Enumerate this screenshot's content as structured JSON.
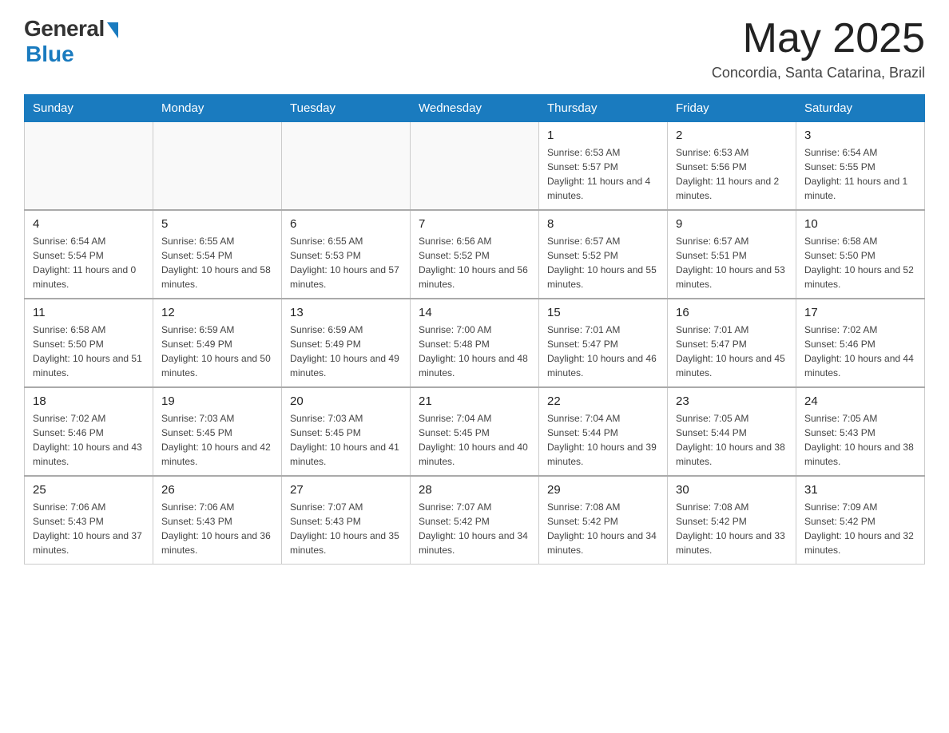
{
  "logo": {
    "general": "General",
    "blue": "Blue"
  },
  "title": "May 2025",
  "location": "Concordia, Santa Catarina, Brazil",
  "days_of_week": [
    "Sunday",
    "Monday",
    "Tuesday",
    "Wednesday",
    "Thursday",
    "Friday",
    "Saturday"
  ],
  "weeks": [
    [
      {
        "day": "",
        "info": ""
      },
      {
        "day": "",
        "info": ""
      },
      {
        "day": "",
        "info": ""
      },
      {
        "day": "",
        "info": ""
      },
      {
        "day": "1",
        "info": "Sunrise: 6:53 AM\nSunset: 5:57 PM\nDaylight: 11 hours and 4 minutes."
      },
      {
        "day": "2",
        "info": "Sunrise: 6:53 AM\nSunset: 5:56 PM\nDaylight: 11 hours and 2 minutes."
      },
      {
        "day": "3",
        "info": "Sunrise: 6:54 AM\nSunset: 5:55 PM\nDaylight: 11 hours and 1 minute."
      }
    ],
    [
      {
        "day": "4",
        "info": "Sunrise: 6:54 AM\nSunset: 5:54 PM\nDaylight: 11 hours and 0 minutes."
      },
      {
        "day": "5",
        "info": "Sunrise: 6:55 AM\nSunset: 5:54 PM\nDaylight: 10 hours and 58 minutes."
      },
      {
        "day": "6",
        "info": "Sunrise: 6:55 AM\nSunset: 5:53 PM\nDaylight: 10 hours and 57 minutes."
      },
      {
        "day": "7",
        "info": "Sunrise: 6:56 AM\nSunset: 5:52 PM\nDaylight: 10 hours and 56 minutes."
      },
      {
        "day": "8",
        "info": "Sunrise: 6:57 AM\nSunset: 5:52 PM\nDaylight: 10 hours and 55 minutes."
      },
      {
        "day": "9",
        "info": "Sunrise: 6:57 AM\nSunset: 5:51 PM\nDaylight: 10 hours and 53 minutes."
      },
      {
        "day": "10",
        "info": "Sunrise: 6:58 AM\nSunset: 5:50 PM\nDaylight: 10 hours and 52 minutes."
      }
    ],
    [
      {
        "day": "11",
        "info": "Sunrise: 6:58 AM\nSunset: 5:50 PM\nDaylight: 10 hours and 51 minutes."
      },
      {
        "day": "12",
        "info": "Sunrise: 6:59 AM\nSunset: 5:49 PM\nDaylight: 10 hours and 50 minutes."
      },
      {
        "day": "13",
        "info": "Sunrise: 6:59 AM\nSunset: 5:49 PM\nDaylight: 10 hours and 49 minutes."
      },
      {
        "day": "14",
        "info": "Sunrise: 7:00 AM\nSunset: 5:48 PM\nDaylight: 10 hours and 48 minutes."
      },
      {
        "day": "15",
        "info": "Sunrise: 7:01 AM\nSunset: 5:47 PM\nDaylight: 10 hours and 46 minutes."
      },
      {
        "day": "16",
        "info": "Sunrise: 7:01 AM\nSunset: 5:47 PM\nDaylight: 10 hours and 45 minutes."
      },
      {
        "day": "17",
        "info": "Sunrise: 7:02 AM\nSunset: 5:46 PM\nDaylight: 10 hours and 44 minutes."
      }
    ],
    [
      {
        "day": "18",
        "info": "Sunrise: 7:02 AM\nSunset: 5:46 PM\nDaylight: 10 hours and 43 minutes."
      },
      {
        "day": "19",
        "info": "Sunrise: 7:03 AM\nSunset: 5:45 PM\nDaylight: 10 hours and 42 minutes."
      },
      {
        "day": "20",
        "info": "Sunrise: 7:03 AM\nSunset: 5:45 PM\nDaylight: 10 hours and 41 minutes."
      },
      {
        "day": "21",
        "info": "Sunrise: 7:04 AM\nSunset: 5:45 PM\nDaylight: 10 hours and 40 minutes."
      },
      {
        "day": "22",
        "info": "Sunrise: 7:04 AM\nSunset: 5:44 PM\nDaylight: 10 hours and 39 minutes."
      },
      {
        "day": "23",
        "info": "Sunrise: 7:05 AM\nSunset: 5:44 PM\nDaylight: 10 hours and 38 minutes."
      },
      {
        "day": "24",
        "info": "Sunrise: 7:05 AM\nSunset: 5:43 PM\nDaylight: 10 hours and 38 minutes."
      }
    ],
    [
      {
        "day": "25",
        "info": "Sunrise: 7:06 AM\nSunset: 5:43 PM\nDaylight: 10 hours and 37 minutes."
      },
      {
        "day": "26",
        "info": "Sunrise: 7:06 AM\nSunset: 5:43 PM\nDaylight: 10 hours and 36 minutes."
      },
      {
        "day": "27",
        "info": "Sunrise: 7:07 AM\nSunset: 5:43 PM\nDaylight: 10 hours and 35 minutes."
      },
      {
        "day": "28",
        "info": "Sunrise: 7:07 AM\nSunset: 5:42 PM\nDaylight: 10 hours and 34 minutes."
      },
      {
        "day": "29",
        "info": "Sunrise: 7:08 AM\nSunset: 5:42 PM\nDaylight: 10 hours and 34 minutes."
      },
      {
        "day": "30",
        "info": "Sunrise: 7:08 AM\nSunset: 5:42 PM\nDaylight: 10 hours and 33 minutes."
      },
      {
        "day": "31",
        "info": "Sunrise: 7:09 AM\nSunset: 5:42 PM\nDaylight: 10 hours and 32 minutes."
      }
    ]
  ]
}
